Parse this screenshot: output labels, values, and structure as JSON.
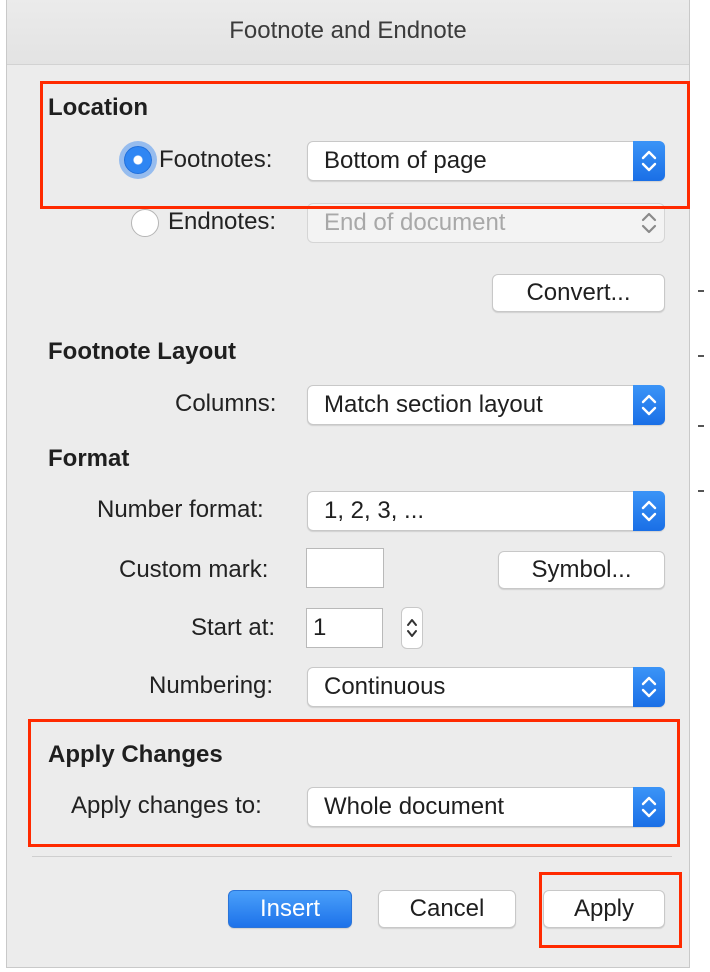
{
  "dialog": {
    "title": "Footnote and Endnote"
  },
  "location": {
    "heading": "Location",
    "footnotes": {
      "label": "Footnotes:",
      "value": "Bottom of page",
      "selected": true
    },
    "endnotes": {
      "label": "Endnotes:",
      "value": "End of document",
      "selected": false,
      "disabled": true
    },
    "convert_label": "Convert..."
  },
  "footnote_layout": {
    "heading": "Footnote Layout",
    "columns_label": "Columns:",
    "columns_value": "Match section layout"
  },
  "format": {
    "heading": "Format",
    "number_format_label": "Number format:",
    "number_format_value": "1, 2, 3, ...",
    "custom_mark_label": "Custom mark:",
    "custom_mark_value": "",
    "symbol_label": "Symbol...",
    "start_at_label": "Start at:",
    "start_at_value": "1",
    "numbering_label": "Numbering:",
    "numbering_value": "Continuous"
  },
  "apply_changes": {
    "heading": "Apply Changes",
    "apply_to_label": "Apply changes to:",
    "apply_to_value": "Whole document"
  },
  "buttons": {
    "insert": "Insert",
    "cancel": "Cancel",
    "apply": "Apply"
  },
  "colors": {
    "accent": "#1d72ea",
    "highlight": "#ff2a00"
  }
}
